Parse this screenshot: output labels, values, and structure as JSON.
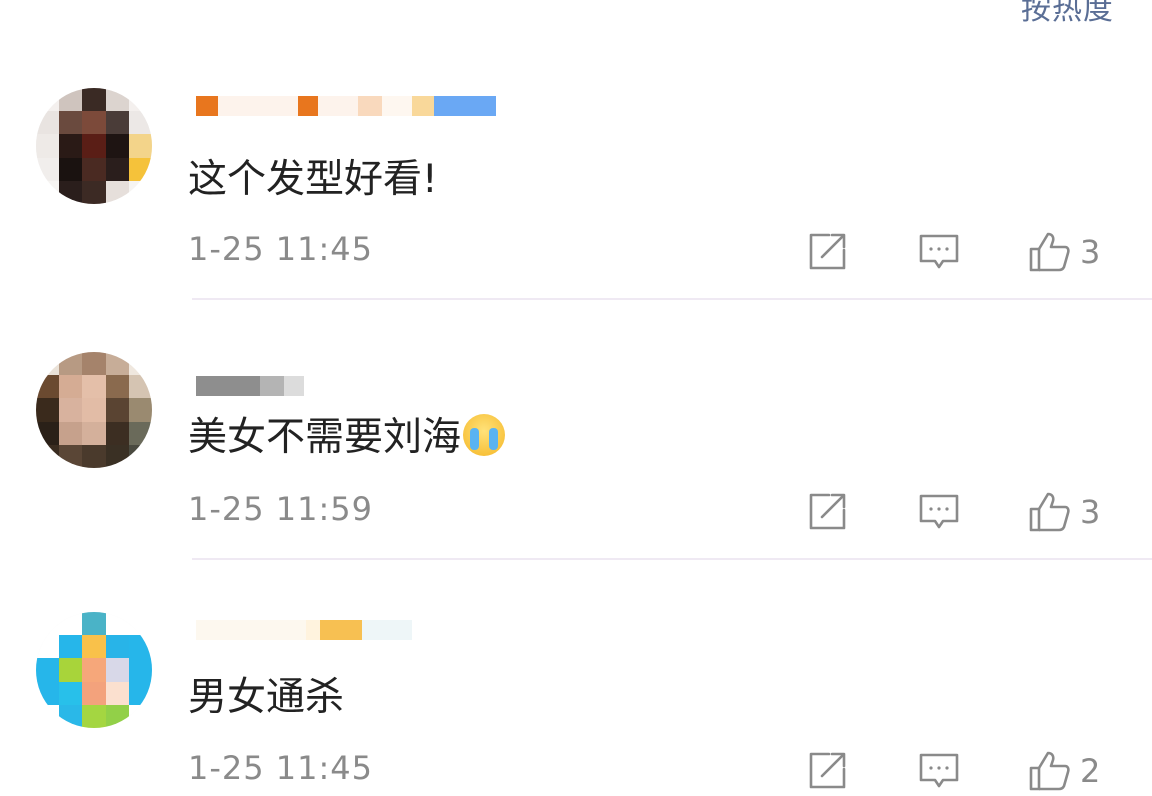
{
  "header": {
    "sort_label": "按热度"
  },
  "comments": [
    {
      "username_redacted": true,
      "text": "这个发型好看!",
      "emoji": "",
      "time": "1-25 11:45",
      "likes": "3"
    },
    {
      "username_redacted": true,
      "text": "美女不需要刘海",
      "emoji": "crying-face-emoji",
      "time": "1-25 11:59",
      "likes": "3"
    },
    {
      "username_redacted": true,
      "text": "男女通杀",
      "emoji": "",
      "time": "1-25 11:45",
      "likes": "2"
    }
  ],
  "icons": {
    "share": "share-icon",
    "reply": "comment-icon",
    "like": "thumbs-up-icon"
  },
  "colors": {
    "text": "#222222",
    "meta": "#8a8a8a",
    "icon": "#8a8a8a",
    "sort_label": "#5a6e95",
    "divider": "#efe9f3"
  }
}
